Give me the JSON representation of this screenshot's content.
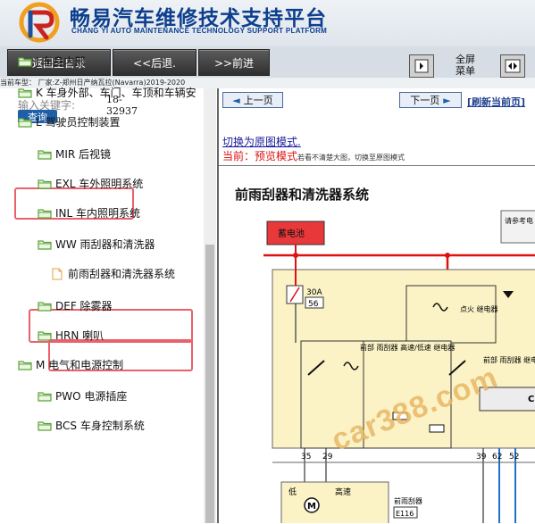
{
  "header": {
    "title": "畅易汽车维修技术支持平台",
    "subtitle": "CHANG YI AUTO MAINTENANCE TECHNOLOGY SUPPORT PLATFORM"
  },
  "toolbar": {
    "home_label": "返回主目录",
    "back_label": "<<后退.",
    "forward_label": ">>前进",
    "fullscreen_label": "全屏 菜单"
  },
  "vehicle_line": "当前车型： 厂家:Z-郑州日产纳瓦拉(Navarra)2019-2020",
  "sidebar": {
    "search_placeholder": "输入关键字:",
    "search_button": "查询",
    "keyword_code": "18-32937",
    "items": [
      {
        "label": "J 车身内部",
        "level": 0
      },
      {
        "label": "K 车身外部、车门、车顶和车辆安",
        "level": 0
      },
      {
        "label": "L 驾驶员控制装置",
        "level": 0,
        "highlighted": true
      },
      {
        "label": "MIR 后视镜",
        "level": 1
      },
      {
        "label": "EXL 车外照明系统",
        "level": 1
      },
      {
        "label": "INL 车内照明系统",
        "level": 1
      },
      {
        "label": "WW 雨刮器和清洗器",
        "level": 1,
        "highlighted": true
      },
      {
        "label": "前雨刮器和清洗器系统",
        "level": 2,
        "highlighted": true
      },
      {
        "label": "DEF 除雾器",
        "level": 1
      },
      {
        "label": "HRN 喇叭",
        "level": 1
      },
      {
        "label": "M 电气和电源控制",
        "level": 0
      },
      {
        "label": "PWO 电源插座",
        "level": 1
      },
      {
        "label": "BCS 车身控制系统",
        "level": 1
      }
    ]
  },
  "content": {
    "prev_page": "上一页",
    "next_page": "下一页",
    "refresh": "[刷新当前页]",
    "switch_mode": "切换为原图模式.",
    "current_label": "当前：",
    "current_mode": "预览模式",
    "current_hint": "若看不清楚大图，切换至原图模式",
    "diagram_title": "前雨刮器和清洗器系统",
    "diagram": {
      "battery": "蓄电池",
      "fuse": "30A",
      "fuse_no": "56",
      "ign_relay": "点火 继电器",
      "front_relay": "前部 雨刮器 高速/低速 继电器",
      "front_relay2": "前部 雨刮器 继电器",
      "note": "请参考电 部分，了",
      "c_label": "C",
      "pins": [
        "35",
        "29",
        "39",
        "62",
        "52"
      ],
      "low": "低",
      "high": "高速",
      "motor_label": "前雨刮器",
      "motor_code": "E116"
    },
    "watermark": "car388.com"
  },
  "colors": {
    "brand_blue": "#0d3f8e",
    "highlight": "#e8616b",
    "folder_green": "#5aa23a",
    "wire_red": "#d11",
    "wire_blue": "#1f6fcf"
  }
}
